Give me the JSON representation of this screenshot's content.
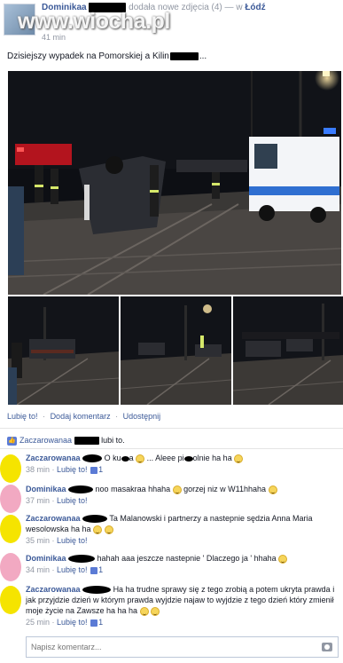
{
  "header": {
    "author": "Dominikaa",
    "action_text": "dodała nowe zdjęcia (4) — w",
    "place": "Łódź",
    "time": "41 min",
    "watermark": "www.wiocha.pl"
  },
  "post": {
    "text": "Dzisiejszy wypadek na Pomorskiej a Kilin",
    "text_tail": "..."
  },
  "actions": {
    "like": "Lubię to!",
    "comment": "Dodaj komentarz",
    "share": "Udostępnij",
    "separator": "·"
  },
  "likes": {
    "name": "Zaczarowanaa",
    "suffix": "lubi to."
  },
  "comments": [
    {
      "name": "Zaczarowanaa",
      "text_a": "O ku",
      "text_b": "a",
      "text_c": "... Aleee pi",
      "text_d": "olnie ha ha",
      "time": "38 min",
      "like": "Lubię to!",
      "count": "1",
      "avatar_color": "#f5e400"
    },
    {
      "name": "Dominikaa",
      "text_a": "noo masakraa hhaha",
      "text_b": "gorzej niz w W11hhaha",
      "time": "37 min",
      "like": "Lubię to!",
      "count": "1",
      "avatar_color": "#f2a9c2"
    },
    {
      "name": "Zaczarowanaa",
      "text_a": "Ta Malanowski i partnerzy a nastepnie sędzia Anna Maria wesolowska ha ha",
      "time": "35 min",
      "like": "Lubię to!",
      "avatar_color": "#f5e400"
    },
    {
      "name": "Dominikaa",
      "text_a": "hahah aaa jeszcze nastepnie ' Dlaczego ja ' hhaha",
      "time": "34 min",
      "like": "Lubię to!",
      "count": "1",
      "avatar_color": "#f2a9c2"
    },
    {
      "name": "Zaczarowanaa",
      "text_a": "Ha ha trudne sprawy się z tego zrobią a potem ukryta prawda i jak przyjdzie dzień w którym prawda wyjdzie najaw to wyjdzie z tego dzień który zmienił moje życie na Zawsze ha ha ha",
      "time": "25 min",
      "like": "Lubię to!",
      "count": "1",
      "avatar_color": "#f5e400"
    }
  ],
  "compose": {
    "placeholder": "Napisz komentarz..."
  },
  "colors": {
    "link": "#3b5998",
    "muted": "#9197a3",
    "like_icon": "#5b7bd5"
  }
}
